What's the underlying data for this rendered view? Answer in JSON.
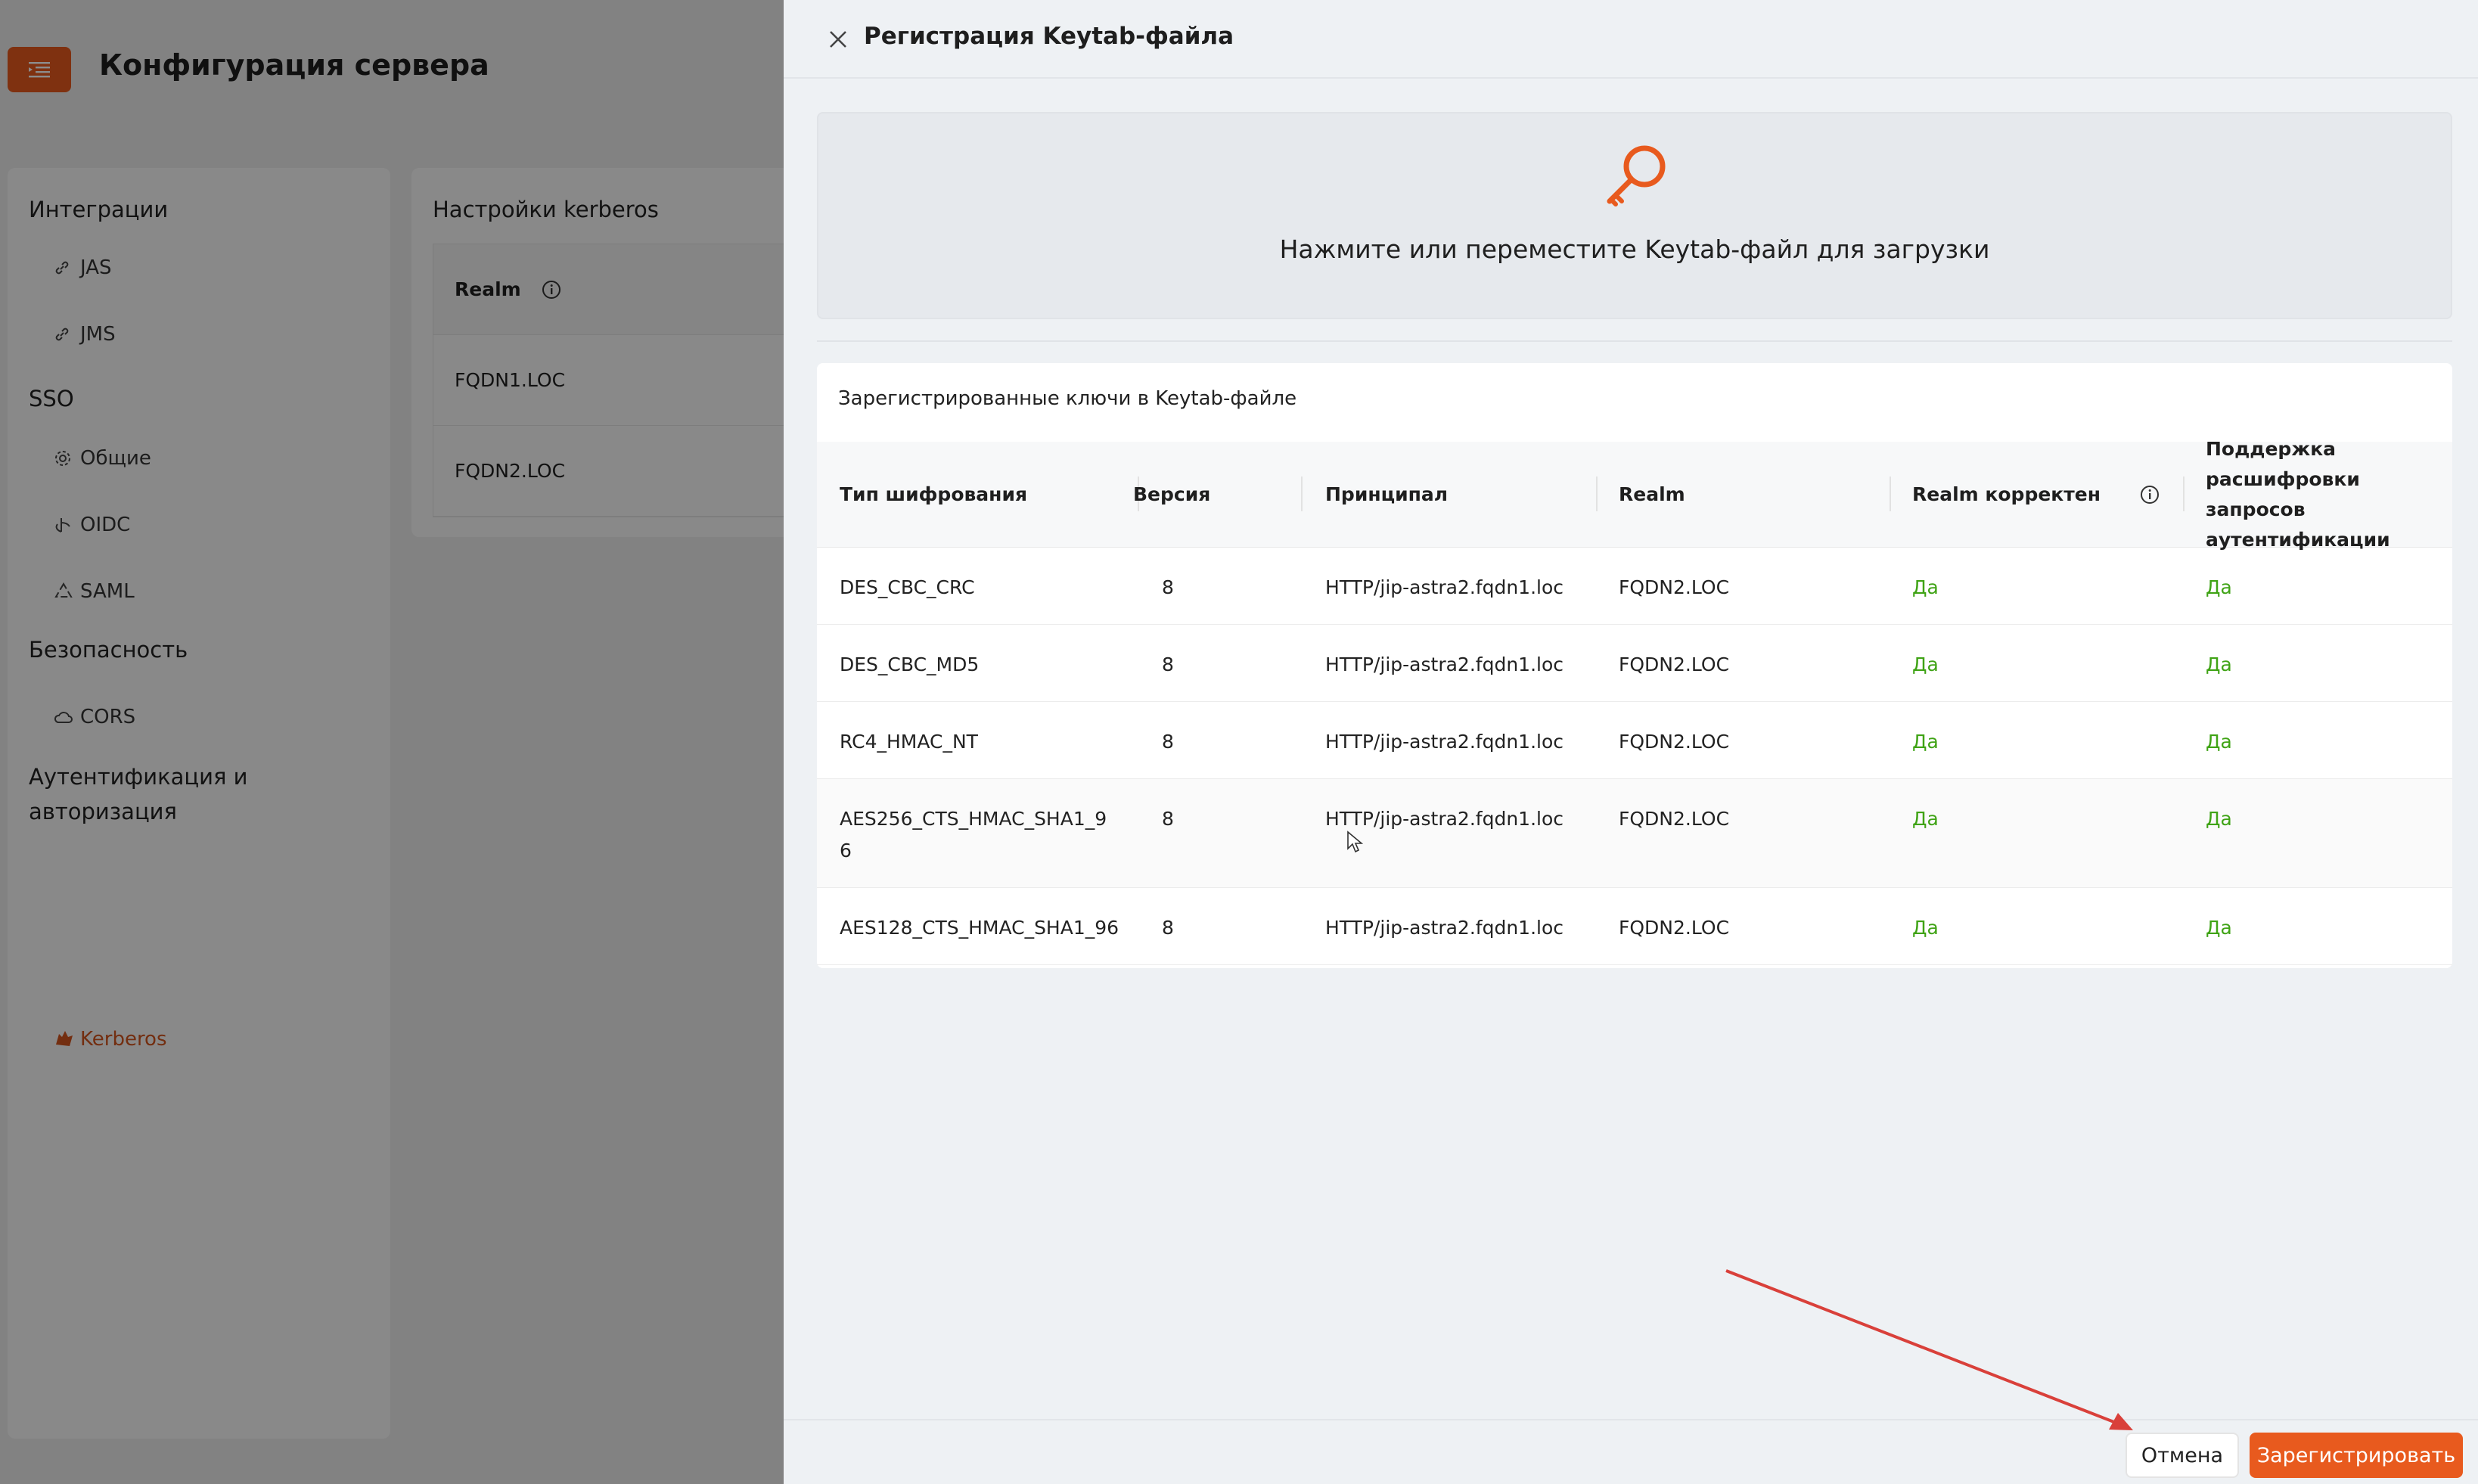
{
  "page": {
    "title": "Конфигурация сервера"
  },
  "sidebar": {
    "groups": [
      {
        "label": "Интеграции"
      },
      {
        "label": "SSO"
      },
      {
        "label": "Безопасность"
      },
      {
        "label": "Аутентификация и авторизация"
      }
    ],
    "items": [
      {
        "label": "JAS",
        "icon": "link-icon"
      },
      {
        "label": "JMS",
        "icon": "link-icon"
      },
      {
        "label": "Общие",
        "icon": "gear-icon"
      },
      {
        "label": "OIDC",
        "icon": "oidc-icon"
      },
      {
        "label": "SAML",
        "icon": "saml-icon"
      },
      {
        "label": "CORS",
        "icon": "cloud-icon"
      },
      {
        "label": "Kerberos",
        "icon": "kerberos-icon"
      }
    ]
  },
  "kerberos_card": {
    "title": "Настройки kerberos",
    "column": "Realm",
    "rows": [
      "FQDN1.LOC",
      "FQDN2.LOC"
    ]
  },
  "drawer": {
    "title": "Регистрация Keytab-файла",
    "dropzone_label": "Нажмите или переместите Keytab-файл для загрузки",
    "keys_title": "Зарегистрированные ключи в Keytab-файле",
    "columns": {
      "enc": "Тип шифрования",
      "version": "Версия",
      "principal": "Принципал",
      "realm": "Realm",
      "realm_ok": "Realm корректен",
      "support_1": "Поддержка расшифровки",
      "support_2": "запросов аутентификации"
    },
    "rows": [
      {
        "enc": "DES_CBC_CRC",
        "version": "8",
        "principal": "HTTP/jip-astra2.fqdn1.loc",
        "realm": "FQDN2.LOC",
        "realm_ok": "Да",
        "support": "Да"
      },
      {
        "enc": "DES_CBC_MD5",
        "version": "8",
        "principal": "HTTP/jip-astra2.fqdn1.loc",
        "realm": "FQDN2.LOC",
        "realm_ok": "Да",
        "support": "Да"
      },
      {
        "enc": "RC4_HMAC_NT",
        "version": "8",
        "principal": "HTTP/jip-astra2.fqdn1.loc",
        "realm": "FQDN2.LOC",
        "realm_ok": "Да",
        "support": "Да"
      },
      {
        "enc_1": "AES256_CTS_HMAC_SHA1_9",
        "enc_2": "6",
        "version": "8",
        "principal": "HTTP/jip-astra2.fqdn1.loc",
        "realm": "FQDN2.LOC",
        "realm_ok": "Да",
        "support": "Да"
      },
      {
        "enc": "AES128_CTS_HMAC_SHA1_96",
        "version": "8",
        "principal": "HTTP/jip-astra2.fqdn1.loc",
        "realm": "FQDN2.LOC",
        "realm_ok": "Да",
        "support": "Да"
      }
    ],
    "cancel_label": "Отмена",
    "register_label": "Зарегистрировать"
  },
  "colors": {
    "accent": "#e85a1e",
    "ok": "#3fa315",
    "annotation_arrow": "#d9403a"
  }
}
